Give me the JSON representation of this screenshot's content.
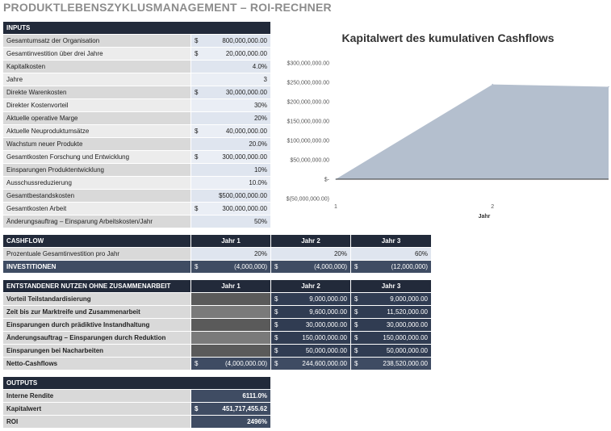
{
  "title": "PRODUKTLEBENSZYKLUSMANAGEMENT – ROI-RECHNER",
  "inputs": {
    "header": "INPUTS",
    "rows": [
      {
        "label": "Gesamtumsatz der Organisation",
        "cur": "$",
        "value": "800,000,000.00"
      },
      {
        "label": "Gesamtinvestition über drei Jahre",
        "cur": "$",
        "value": "20,000,000.00"
      },
      {
        "label": "Kapitalkosten",
        "cur": "",
        "value": "4.0%"
      },
      {
        "label": "Jahre",
        "cur": "",
        "value": "3"
      },
      {
        "label": "Direkte Warenkosten",
        "cur": "$",
        "value": "30,000,000.00"
      },
      {
        "label": "Direkter Kostenvorteil",
        "cur": "",
        "value": "30%"
      },
      {
        "label": "Aktuelle operative Marge",
        "cur": "",
        "value": "20%"
      },
      {
        "label": "Aktuelle Neuproduktumsätze",
        "cur": "$",
        "value": "40,000,000.00"
      },
      {
        "label": "Wachstum neuer Produkte",
        "cur": "",
        "value": "20.0%"
      },
      {
        "label": "Gesamtkosten Forschung und Entwicklung",
        "cur": "$",
        "value": "300,000,000.00"
      },
      {
        "label": "Einsparungen Produktentwicklung",
        "cur": "",
        "value": "10%"
      },
      {
        "label": "Ausschussreduzierung",
        "cur": "",
        "value": "10.0%"
      },
      {
        "label": "Gesamtbestandskosten",
        "cur": "",
        "value": "$500,000,000.00"
      },
      {
        "label": "Gesamtkosten Arbeit",
        "cur": "$",
        "value": "300,000,000.00"
      },
      {
        "label": "Änderungsauftrag – Einsparung Arbeitskosten/Jahr",
        "cur": "",
        "value": "50%"
      }
    ]
  },
  "cashflow": {
    "header": "CASHFLOW",
    "years": [
      "Jahr 1",
      "Jahr 2",
      "Jahr 3"
    ],
    "pct_label": "Prozentuale Gesamtinvestition pro Jahr",
    "pct": [
      "20%",
      "20%",
      "60%"
    ],
    "inv_label": "INVESTITIONEN",
    "inv": [
      "(4,000,000)",
      "(4,000,000)",
      "(12,000,000)"
    ]
  },
  "benefits": {
    "header": "ENTSTANDENER NUTZEN OHNE ZUSAMMENARBEIT",
    "years": [
      "Jahr 1",
      "Jahr 2",
      "Jahr 3"
    ],
    "rows": [
      {
        "label": "Vorteil Teilstandardisierung",
        "y1": "",
        "y2": "9,000,000.00",
        "y3": "9,000,000.00"
      },
      {
        "label": "Zeit bis zur Marktreife und Zusammenarbeit",
        "y1": "",
        "y2": "9,600,000.00",
        "y3": "11,520,000.00"
      },
      {
        "label": "Einsparungen durch prädiktive Instandhaltung",
        "y1": "",
        "y2": "30,000,000.00",
        "y3": "30,000,000.00"
      },
      {
        "label": "Änderungsauftrag – Einsparungen durch Reduktion",
        "y1": "",
        "y2": "150,000,000.00",
        "y3": "150,000,000.00"
      },
      {
        "label": "Einsparungen bei Nacharbeiten",
        "y1": "",
        "y2": "50,000,000.00",
        "y3": "50,000,000.00"
      }
    ],
    "net_label": "Netto-Cashflows",
    "net": [
      "(4,000,000.00)",
      "244,600,000.00",
      "238,520,000.00"
    ]
  },
  "outputs": {
    "header": "OUTPUTS",
    "rows": [
      {
        "label": "Interne Rendite",
        "cur": "",
        "value": "6111.0%"
      },
      {
        "label": "Kapitalwert",
        "cur": "$",
        "value": "451,717,455.62"
      },
      {
        "label": "ROI",
        "cur": "",
        "value": "2496%"
      }
    ]
  },
  "chart_data": {
    "type": "area",
    "title": "Kapitalwert des kumulativen Cashflows",
    "xlabel": "Jahr",
    "ylabel": "",
    "x": [
      1,
      2,
      3
    ],
    "x_ticks": [
      "1",
      "2"
    ],
    "values": [
      0,
      244600000,
      238520000
    ],
    "ylim": [
      -50000000,
      300000000
    ],
    "y_ticks": [
      "$(50,000,000.00)",
      "$-",
      "$50,000,000.00",
      "$100,000,000.00",
      "$150,000,000.00",
      "$200,000,000.00",
      "$250,000,000.00",
      "$300,000,000.00"
    ],
    "y_tick_values": [
      -50000000,
      0,
      50000000,
      100000000,
      150000000,
      200000000,
      250000000,
      300000000
    ],
    "grid": false,
    "fill_color": "#b4bfce",
    "line_color": "#b4bfce"
  }
}
